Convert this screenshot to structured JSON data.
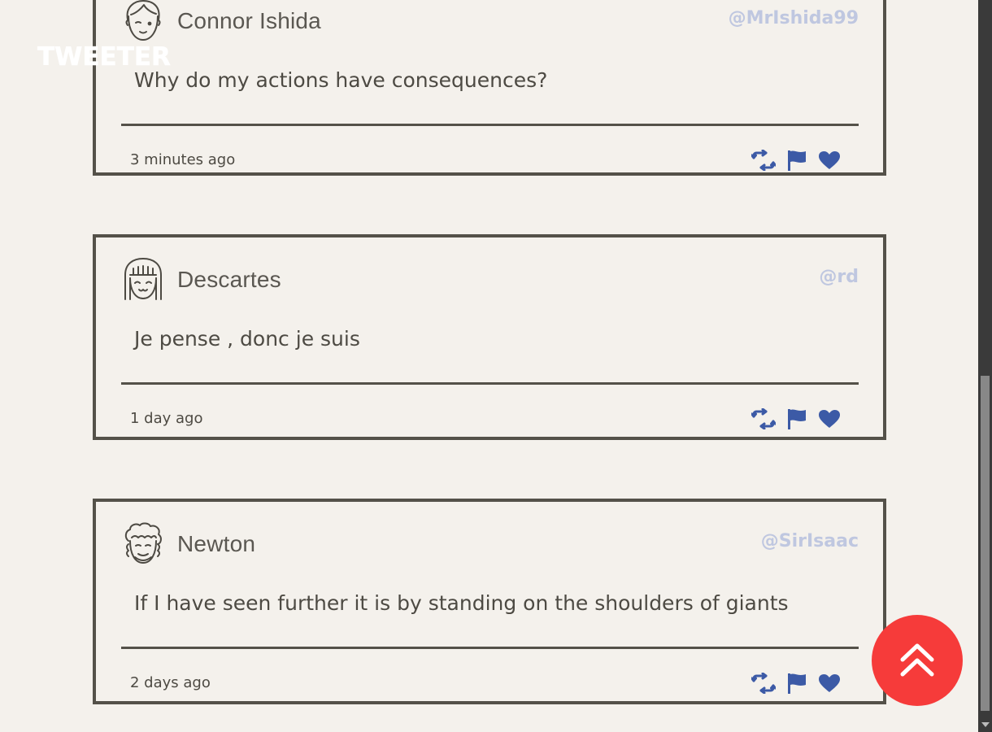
{
  "app": {
    "brand": "TWEETER"
  },
  "tweets": [
    {
      "name": "Connor Ishida",
      "handle": "@MrIshida99",
      "content": "Why do my actions have consequences?",
      "timestamp": "3 minutes ago",
      "avatar_icon": "boy-avatar-icon"
    },
    {
      "name": "Descartes",
      "handle": "@rd",
      "content": "Je pense , donc je suis",
      "timestamp": "1 day ago",
      "avatar_icon": "girl-avatar-icon"
    },
    {
      "name": "Newton",
      "handle": "@SirIsaac",
      "content": "If I have seen further it is by standing on the shoulders of giants",
      "timestamp": "2 days ago",
      "avatar_icon": "curly-hair-avatar-icon"
    }
  ],
  "actions": {
    "retweet_icon": "retweet-icon",
    "flag_icon": "flag-icon",
    "like_icon": "heart-icon"
  },
  "scroll_top": {
    "icon": "double-chevron-up-icon"
  },
  "colors": {
    "background": "#f4f1ec",
    "border": "#545149",
    "handle": "#bfc7e0",
    "action_icons": "#3c5aa6",
    "scroll_top_button": "#f63b3a"
  }
}
